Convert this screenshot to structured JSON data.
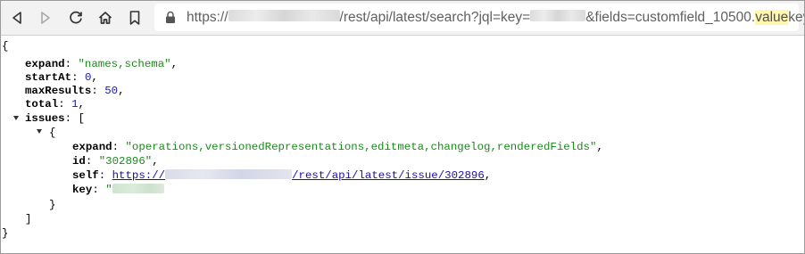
{
  "toolbar": {
    "back_icon": "back-arrow-icon",
    "forward_icon": "forward-arrow-icon",
    "reload_icon": "reload-icon",
    "home_icon": "home-icon",
    "bookmark_icon": "bookmark-icon",
    "lock_icon": "lock-icon"
  },
  "url": {
    "prefix": "https://",
    "path": "/rest/api/latest/search?jql=key=",
    "query": "&fields=customfield_10500.",
    "highlight": "value",
    "suffix": "key"
  },
  "json": {
    "open_brace": "{",
    "close_brace": "}",
    "expand_key": "expand",
    "expand_value": "\"names,schema\"",
    "startAt_key": "startAt",
    "startAt_value": "0",
    "maxResults_key": "maxResults",
    "maxResults_value": "50",
    "total_key": "total",
    "total_value": "1",
    "issues_key": "issues",
    "open_bracket": "[",
    "close_bracket": "]",
    "issue": {
      "expand_key": "expand",
      "expand_value": "\"operations,versionedRepresentations,editmeta,changelog,renderedFields\"",
      "id_key": "id",
      "id_value": "\"302896\"",
      "self_key": "self",
      "self_prefix": "https://",
      "self_path": "/rest/api/latest/issue/302896",
      "key_key": "key",
      "key_open_quote": "\""
    }
  },
  "colors": {
    "string": "#1a8a1a",
    "number": "#1a1aa6",
    "link": "#1a0dab",
    "url_highlight": "#fff6b0"
  }
}
